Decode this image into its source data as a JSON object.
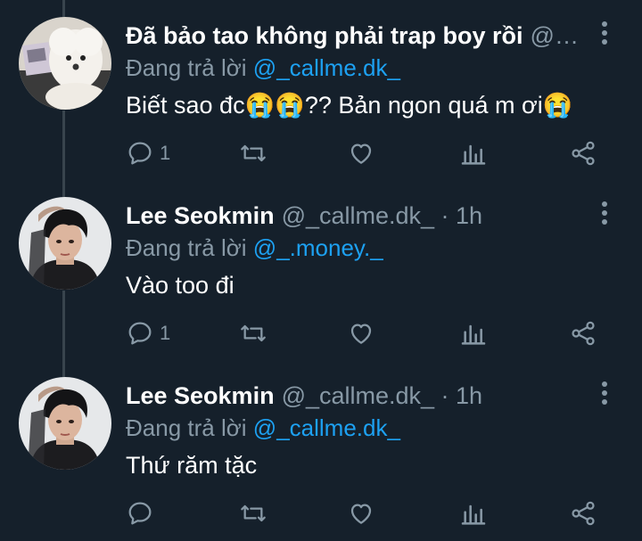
{
  "tweets": [
    {
      "name": "Đã bảo tao không phải trap boy rồi",
      "meta": "@_....",
      "replying_prefix": "Đang trả lời",
      "replying_to": "@_callme.dk_",
      "text": "Biết sao đc😭😭?? Bản ngon quá m ơi😭",
      "reply_count": "1",
      "avatar": "white-dog-avatar"
    },
    {
      "name": "Lee Seokmin",
      "meta": "@_callme.dk_ · 1h",
      "replying_prefix": "Đang trả lời",
      "replying_to": "@_.money._",
      "text": "Vào too đi",
      "reply_count": "1",
      "avatar": "dark-haired-man-avatar"
    },
    {
      "name": "Lee Seokmin",
      "meta": "@_callme.dk_ · 1h",
      "replying_prefix": "Đang trả lời",
      "replying_to": "@_callme.dk_",
      "text": "Thứ răm tặc",
      "reply_count": "",
      "avatar": "dark-haired-man-avatar"
    }
  ],
  "colors": {
    "background": "#15202b",
    "secondary_text": "#8899a6",
    "mention": "#1da1f2",
    "thread_line": "#38444d"
  },
  "icons": [
    "reply-icon",
    "retweet-icon",
    "like-icon",
    "analytics-icon",
    "share-icon",
    "more-options-icon"
  ]
}
